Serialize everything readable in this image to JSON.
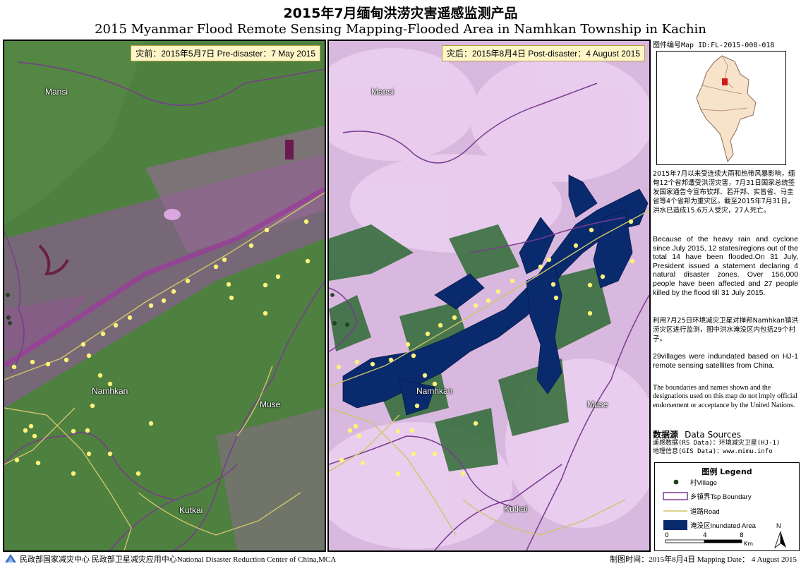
{
  "title": {
    "cn": "2015年7月缅甸洪涝灾害遥感监测产品",
    "en": "2015 Myanmar Flood Remote Sensing Mapping-Flooded Area in  Namhkan Township in Kachin"
  },
  "panels": {
    "pre": {
      "label": "灾前：2015年5月7日 Pre-disaster：7 May 2015"
    },
    "post": {
      "label": "灾后：2015年8月4日 Post-disaster：4 August 2015"
    }
  },
  "places": {
    "mansi": "Mansi",
    "namhkan": "Namhkan",
    "muse": "Muse",
    "kutkai": "Kutkai"
  },
  "map_id": "图件编号Map ID:FL-2015-008-018",
  "description": {
    "cn1": "2015年7月以来受连续大雨和热带风暴影响，缅甸12个省邦遭受洪涝灾害，7月31日国家总统签发国家通告令宣布钦邦、若开邦、实皆省、马圭省等4个省邦为重灾区。截至2015年7月31日，洪水已造成15.6万人受灾，27人死亡。",
    "en1": "Because of the heavy rain and cyclone since July 2015, 12 states/regions out of the total 14 have been flooded.On 31 July, President issued a statement declaring 4 natural disaster zones. Over 156,000 people have been affected and 27 people killed by the flood till 31 July 2015.",
    "cn2": "利用7月25日环境减灾卫星对掸邦Namhkan镇洪涝灾区进行监测，图中洪水淹没区内包括29个村子。",
    "en2": "29villages were indundated based on HJ-1 remote sensing satellites from China.",
    "disclaimer": "The boundaries and names shown and the designations used on this map do not imply official endorsement or acceptance by the United Nations."
  },
  "data_sources": {
    "title_cn": "数据源",
    "title_en": "Data Sources",
    "rs": "遥感数据(RS Data)：环境减灾卫星(HJ-1)",
    "gis": "地理信息(GIS Data)：www.mimu.info"
  },
  "legend": {
    "title": "图例 Legend",
    "village": "村Village",
    "boundary": "乡镇界Tsp Boundary",
    "road": "道路Road",
    "inundated": "淹没区Inundated Area",
    "north": "N",
    "scale_ticks": [
      "0",
      "4",
      "8"
    ],
    "scale_unit": "Km"
  },
  "footer": {
    "org": "民政部国家减灾中心   民政部卫星减灾应用中心National Disaster Reduction Center of China,MCA",
    "date": "制图时间：2015年8月4日   Mapping Date： 4 August 2015"
  },
  "colors": {
    "flood": "#0a2a6e",
    "village": "#fff27a",
    "boundary": "#7a3a8e",
    "road": "#cfc46a",
    "vegetation": "#5a8a42",
    "cloud": "#e9cdee"
  }
}
